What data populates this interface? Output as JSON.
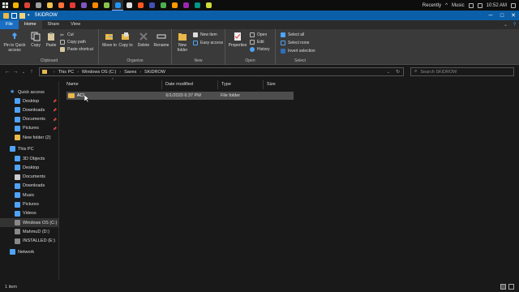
{
  "taskbar": {
    "icons": [
      {
        "name": "explorer",
        "color": "#f0b400"
      },
      {
        "name": "chrome",
        "color": "#db4437"
      },
      {
        "name": "clock",
        "color": "#9e9e9e"
      },
      {
        "name": "folder",
        "color": "#f0c14b"
      },
      {
        "name": "firefox",
        "color": "#ff7139"
      },
      {
        "name": "app-red",
        "color": "#e53935"
      },
      {
        "name": "media",
        "color": "#7e57c2"
      },
      {
        "name": "vlc",
        "color": "#ff8800"
      },
      {
        "name": "settings",
        "color": "#8bc34a"
      },
      {
        "name": "active-window",
        "color": "#2196f3"
      },
      {
        "name": "shield",
        "color": "#e0e0e0"
      },
      {
        "name": "tool",
        "color": "#ff5722"
      },
      {
        "name": "app-blue",
        "color": "#3f51b5"
      },
      {
        "name": "app-green",
        "color": "#4caf50"
      },
      {
        "name": "app-orange",
        "color": "#ff9800"
      },
      {
        "name": "app-purple",
        "color": "#9c27b0"
      },
      {
        "name": "app-teal",
        "color": "#009688"
      },
      {
        "name": "app-yellow",
        "color": "#cddc39"
      }
    ],
    "tray": {
      "recently": "Recently",
      "music": "Music",
      "time": "10:52 AM"
    }
  },
  "window": {
    "title": "SKiDROW"
  },
  "ribbon_tabs": [
    "File",
    "Home",
    "Share",
    "View"
  ],
  "ribbon": {
    "clipboard": {
      "label": "Clipboard",
      "pin": "Pin to Quick access",
      "copy": "Copy",
      "paste": "Paste",
      "cut": "Cut",
      "copy_path": "Copy path",
      "paste_shortcut": "Paste shortcut"
    },
    "organize": {
      "label": "Organize",
      "move_to": "Move to",
      "copy_to": "Copy to",
      "delete": "Delete",
      "rename": "Rename"
    },
    "new": {
      "label": "New",
      "new_folder": "New folder",
      "new_item": "New item",
      "easy_access": "Easy access"
    },
    "open": {
      "label": "Open",
      "properties": "Properties",
      "open": "Open",
      "edit": "Edit",
      "history": "History"
    },
    "select": {
      "label": "Select",
      "select_all": "Select all",
      "select_none": "Select none",
      "invert": "Invert selection"
    }
  },
  "address": {
    "crumbs": [
      "This PC",
      "Windows OS (C:)",
      "Saves",
      "SKiDROW"
    ],
    "search_placeholder": "Search SKiDROW"
  },
  "nav": {
    "quick_access": "Quick access",
    "quick_items": [
      {
        "label": "Desktop",
        "pinned": true
      },
      {
        "label": "Downloads",
        "pinned": true
      },
      {
        "label": "Documents",
        "pinned": true
      },
      {
        "label": "Pictures",
        "pinned": true
      },
      {
        "label": "New folder (2)",
        "pinned": false
      }
    ],
    "this_pc": "This PC",
    "pc_items": [
      "3D Objects",
      "Desktop",
      "Documents",
      "Downloads",
      "Music",
      "Pictures",
      "Videos",
      "Windows OS (C:)",
      "MahmuD (D:)",
      "INSTALLED (E:)"
    ],
    "network": "Network"
  },
  "columns": [
    "Name",
    "Date modified",
    "Type",
    "Size"
  ],
  "files": [
    {
      "name": "ACL",
      "date": "6/1/2020 6:37 PM",
      "type": "File folder",
      "size": ""
    }
  ],
  "status": {
    "count": "1 item"
  },
  "colors": {
    "title_bar": "#0b5ea8",
    "file_tab": "#1a6fc4",
    "folder": "#e8b84a",
    "selection": "#4d4d4d"
  }
}
